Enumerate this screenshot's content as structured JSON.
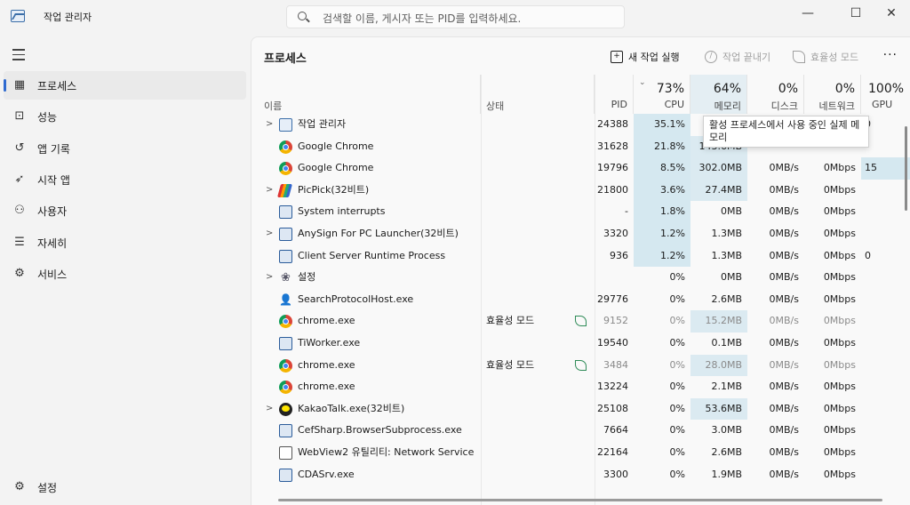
{
  "app": {
    "title": "작업 관리자"
  },
  "search": {
    "placeholder": "검색할 이름, 게시자 또는 PID를 입력하세요."
  },
  "window_controls": {
    "minimize": "—",
    "maximize": "☐",
    "close": "✕"
  },
  "sidebar": {
    "items": [
      {
        "label": "프로세스",
        "icon": "processes-icon",
        "glyph": "▦",
        "active": true
      },
      {
        "label": "성능",
        "icon": "performance-icon",
        "glyph": "⊡",
        "active": false
      },
      {
        "label": "앱 기록",
        "icon": "history-icon",
        "glyph": "↺",
        "active": false
      },
      {
        "label": "시작 앱",
        "icon": "startup-icon",
        "glyph": "➶",
        "active": false
      },
      {
        "label": "사용자",
        "icon": "users-icon",
        "glyph": "⚇",
        "active": false
      },
      {
        "label": "자세히",
        "icon": "details-icon",
        "glyph": "☰",
        "active": false
      },
      {
        "label": "서비스",
        "icon": "services-icon",
        "glyph": "⚙",
        "active": false
      }
    ],
    "settings": {
      "label": "설정",
      "icon": "settings-icon",
      "glyph": "⚙"
    }
  },
  "toolbar": {
    "title": "프로세스",
    "run_new_task": "새 작업 실행",
    "end_task": "작업 끝내기",
    "efficiency_mode": "효율성 모드",
    "more": "···"
  },
  "columns": {
    "name": "이름",
    "status": "상태",
    "pid": "PID",
    "cpu": {
      "pct": "73%",
      "label": "CPU"
    },
    "memory": {
      "pct": "64%",
      "label": "메모리"
    },
    "disk": {
      "pct": "0%",
      "label": "디스크"
    },
    "network": {
      "pct": "0%",
      "label": "네트워크"
    },
    "gpu": {
      "pct": "100%",
      "label": "GPU"
    }
  },
  "tooltip": "활성 프로세스에서 사용 중인 실제 메모리",
  "processes": [
    {
      "name": "작업 관리자",
      "icon": "taskmgr",
      "expand": true,
      "status": "",
      "pid": "24388",
      "cpu": "35.1%",
      "mem": "",
      "disk": "",
      "net": "",
      "gpu": "0"
    },
    {
      "name": "Google Chrome",
      "icon": "chrome",
      "expand": false,
      "status": "",
      "pid": "31628",
      "cpu": "21.8%",
      "mem": "143.6MB",
      "disk": "",
      "net": "",
      "gpu": ""
    },
    {
      "name": "Google Chrome",
      "icon": "chrome",
      "expand": false,
      "status": "",
      "pid": "19796",
      "cpu": "8.5%",
      "mem": "302.0MB",
      "disk": "0MB/s",
      "net": "0Mbps",
      "gpu": "15"
    },
    {
      "name": "PicPick(32비트)",
      "icon": "picpick",
      "expand": true,
      "status": "",
      "pid": "21800",
      "cpu": "3.6%",
      "mem": "27.4MB",
      "disk": "0MB/s",
      "net": "0Mbps",
      "gpu": ""
    },
    {
      "name": "System interrupts",
      "icon": "win",
      "expand": false,
      "status": "",
      "pid": "-",
      "cpu": "1.8%",
      "mem": "0MB",
      "disk": "0MB/s",
      "net": "0Mbps",
      "gpu": ""
    },
    {
      "name": "AnySign For PC Launcher(32비트)",
      "icon": "win",
      "expand": true,
      "status": "",
      "pid": "3320",
      "cpu": "1.2%",
      "mem": "1.3MB",
      "disk": "0MB/s",
      "net": "0Mbps",
      "gpu": ""
    },
    {
      "name": "Client Server Runtime Process",
      "icon": "win",
      "expand": false,
      "status": "",
      "pid": "936",
      "cpu": "1.2%",
      "mem": "1.3MB",
      "disk": "0MB/s",
      "net": "0Mbps",
      "gpu": "0"
    },
    {
      "name": "설정",
      "icon": "gear",
      "expand": true,
      "status": "",
      "pid": "",
      "cpu": "0%",
      "mem": "0MB",
      "disk": "0MB/s",
      "net": "0Mbps",
      "gpu": ""
    },
    {
      "name": "SearchProtocolHost.exe",
      "icon": "user",
      "expand": false,
      "status": "",
      "pid": "29776",
      "cpu": "0%",
      "mem": "2.6MB",
      "disk": "0MB/s",
      "net": "0Mbps",
      "gpu": ""
    },
    {
      "name": "chrome.exe",
      "icon": "chrome",
      "expand": false,
      "status": "효율성 모드",
      "pid": "9152",
      "cpu": "0%",
      "mem": "15.2MB",
      "disk": "0MB/s",
      "net": "0Mbps",
      "gpu": ""
    },
    {
      "name": "TiWorker.exe",
      "icon": "win",
      "expand": false,
      "status": "",
      "pid": "19540",
      "cpu": "0%",
      "mem": "0.1MB",
      "disk": "0MB/s",
      "net": "0Mbps",
      "gpu": ""
    },
    {
      "name": "chrome.exe",
      "icon": "chrome",
      "expand": false,
      "status": "효율성 모드",
      "pid": "3484",
      "cpu": "0%",
      "mem": "28.0MB",
      "disk": "0MB/s",
      "net": "0Mbps",
      "gpu": ""
    },
    {
      "name": "chrome.exe",
      "icon": "chrome",
      "expand": false,
      "status": "",
      "pid": "13224",
      "cpu": "0%",
      "mem": "2.1MB",
      "disk": "0MB/s",
      "net": "0Mbps",
      "gpu": ""
    },
    {
      "name": "KakaoTalk.exe(32비트)",
      "icon": "kakao",
      "expand": true,
      "status": "",
      "pid": "25108",
      "cpu": "0%",
      "mem": "53.6MB",
      "disk": "0MB/s",
      "net": "0Mbps",
      "gpu": ""
    },
    {
      "name": "CefSharp.BrowserSubprocess.exe",
      "icon": "win",
      "expand": false,
      "status": "",
      "pid": "7664",
      "cpu": "0%",
      "mem": "3.0MB",
      "disk": "0MB/s",
      "net": "0Mbps",
      "gpu": ""
    },
    {
      "name": "WebView2 유틸리티: Network Service",
      "icon": "bag",
      "expand": false,
      "status": "",
      "pid": "22164",
      "cpu": "0%",
      "mem": "2.6MB",
      "disk": "0MB/s",
      "net": "0Mbps",
      "gpu": ""
    },
    {
      "name": "CDASrv.exe",
      "icon": "win",
      "expand": false,
      "status": "",
      "pid": "3300",
      "cpu": "0%",
      "mem": "1.9MB",
      "disk": "0MB/s",
      "net": "0Mbps",
      "gpu": ""
    }
  ],
  "colors": {
    "accent": "#2f6ad0",
    "cpu_heat": "#d5e8f0",
    "mem_heat": "#dbeaf1",
    "efficiency_leaf": "#2e8b57"
  }
}
